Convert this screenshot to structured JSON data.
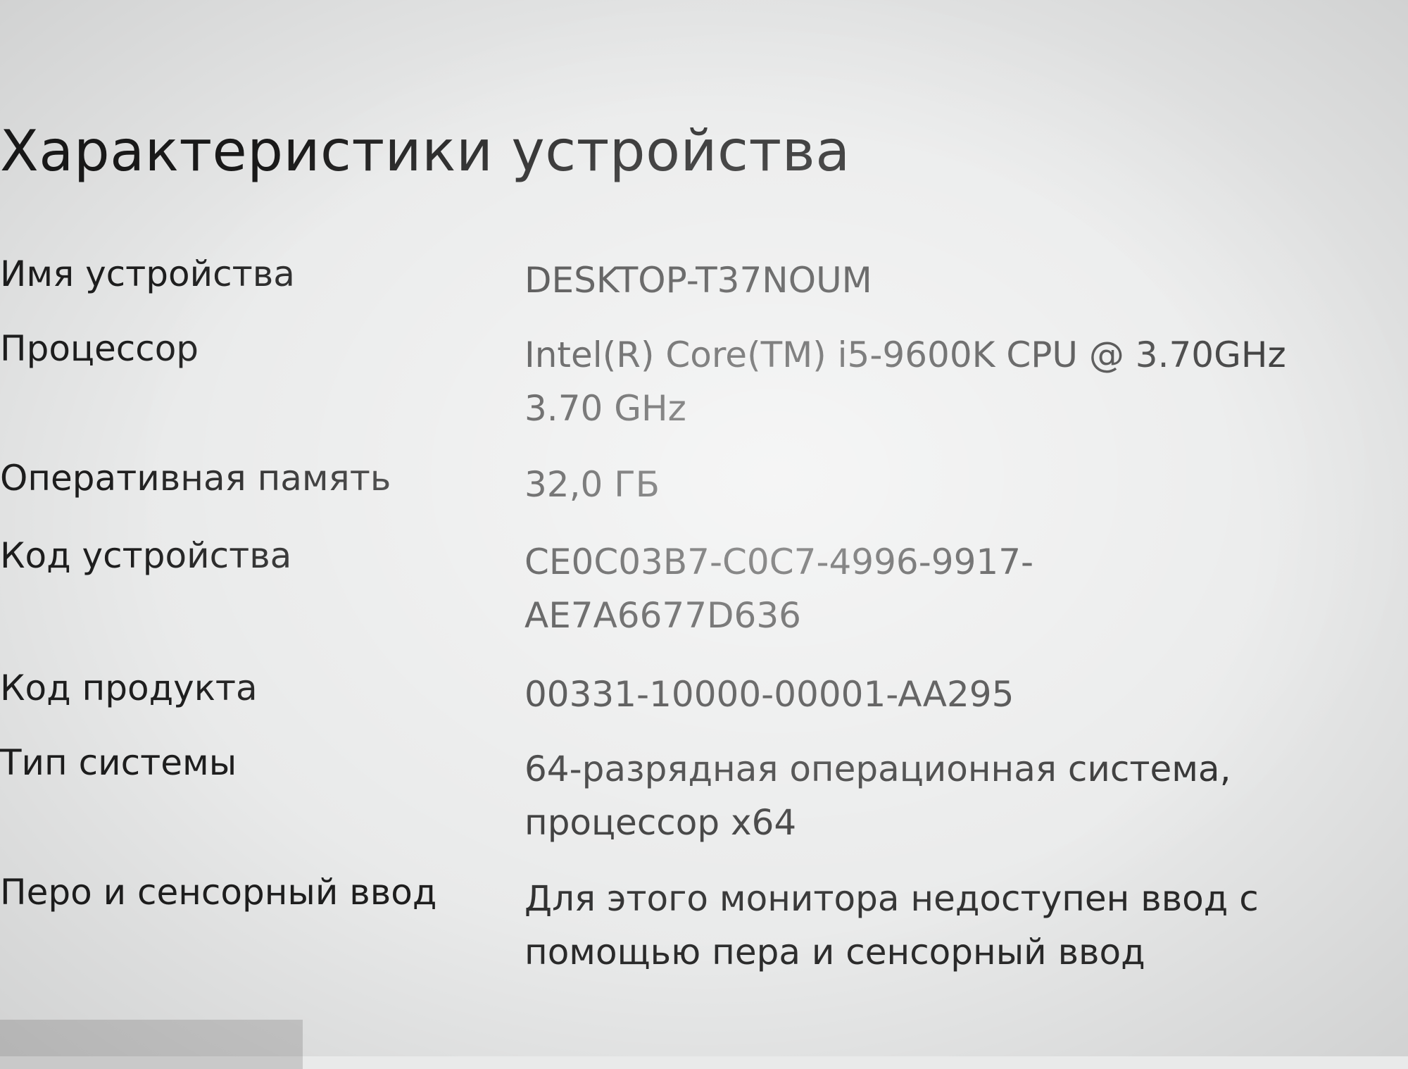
{
  "section": {
    "title": "Характеристики устройства"
  },
  "specs": [
    {
      "label": "Имя устройства",
      "value": "DESKTOP-T37NOUM"
    },
    {
      "label": "Процессор",
      "value": "Intel(R) Core(TM) i5-9600K CPU @ 3.70GHz\n3.70 GHz"
    },
    {
      "label": "Оперативная память",
      "value": "32,0 ГБ"
    },
    {
      "label": "Код устройства",
      "value": "CE0C03B7-C0C7-4996-9917-\nAE7A6677D636"
    },
    {
      "label": "Код продукта",
      "value": "00331-10000-00001-AA295"
    },
    {
      "label": "Тип системы",
      "value": "64-разрядная операционная система,\nпроцессор x64"
    },
    {
      "label": "Перо и сенсорный ввод",
      "value": "Для этого монитора недоступен ввод с\nпомощью пера и сенсорный ввод"
    }
  ]
}
